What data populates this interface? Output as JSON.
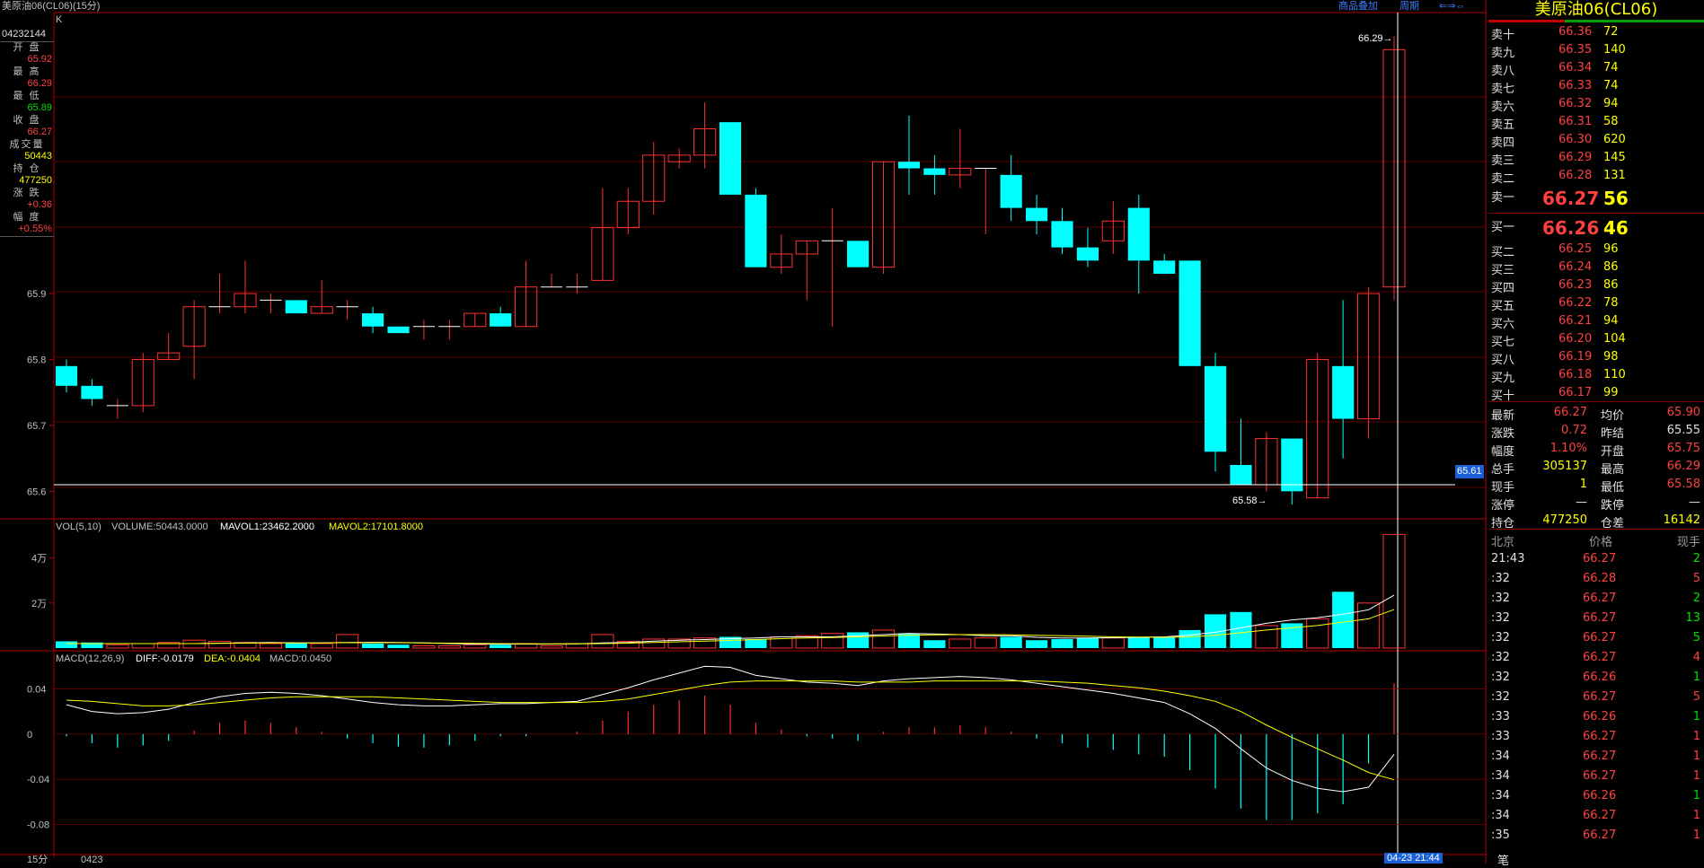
{
  "window_title": "美原油06(CL06)(15分)",
  "toolbar": {
    "overlay_label": "商品叠加",
    "period_label": "周期",
    "k_label": "K",
    "period_bottom": "15分",
    "date_bottom": "0423"
  },
  "info": {
    "code": "04232144",
    "open_label": "开 盘",
    "open": "65.92",
    "high_label": "最 高",
    "high": "66.29",
    "low_label": "最 低",
    "low": "65.89",
    "close_label": "收 盘",
    "close": "66.27",
    "vol_label": "成交量",
    "vol": "50443",
    "oi_label": "持 仓",
    "oi": "477250",
    "chg_label": "涨 跌",
    "chg": "+0.36",
    "pct_label": "幅 度",
    "pct": "+0.55%"
  },
  "price_marker": "65.61",
  "time_marker": "04-23 21:44",
  "high_annot": "66.29→",
  "low_annot": "65.58→",
  "vol_header": {
    "name": "VOL(5,10)",
    "volume": "VOLUME:50443.0000",
    "ma1": "MAVOL1:23462.2000",
    "ma2": "MAVOL2:17101.8000"
  },
  "macd_header": {
    "name": "MACD(12,26,9)",
    "diff": "DIFF:-0.0179",
    "dea": "DEA:-0.0404",
    "macd": "MACD:0.0450"
  },
  "colors": {
    "up": "#ff3030",
    "down": "#00ffff",
    "grid": "#7a0000",
    "ma1": "#ffffff",
    "ma2": "#ffff00"
  },
  "chart_data": {
    "type": "candlestick",
    "price_axis": {
      "ticks": [
        "65.6",
        "65.7",
        "65.8",
        "65.9"
      ],
      "ylim": [
        65.58,
        66.31
      ]
    },
    "vol_axis": {
      "ticks": [
        "2万",
        "4万"
      ],
      "ylim": [
        0,
        51000
      ]
    },
    "macd_axis": {
      "ticks": [
        "0.04",
        "0",
        "-0.04",
        "-0.08"
      ],
      "ylim": [
        -0.105,
        0.065
      ]
    },
    "candles": [
      [
        65.79,
        65.8,
        65.75,
        65.76
      ],
      [
        65.76,
        65.77,
        65.73,
        65.74
      ],
      [
        65.73,
        65.74,
        65.71,
        65.73
      ],
      [
        65.73,
        65.81,
        65.72,
        65.8
      ],
      [
        65.8,
        65.84,
        65.8,
        65.81
      ],
      [
        65.82,
        65.89,
        65.77,
        65.88
      ],
      [
        65.88,
        65.93,
        65.87,
        65.88
      ],
      [
        65.88,
        65.95,
        65.87,
        65.9
      ],
      [
        65.89,
        65.9,
        65.87,
        65.89
      ],
      [
        65.89,
        65.89,
        65.87,
        65.87
      ],
      [
        65.87,
        65.92,
        65.87,
        65.88
      ],
      [
        65.88,
        65.89,
        65.86,
        65.88
      ],
      [
        65.87,
        65.88,
        65.84,
        65.85
      ],
      [
        65.85,
        65.85,
        65.84,
        65.84
      ],
      [
        65.85,
        65.86,
        65.83,
        65.85
      ],
      [
        65.85,
        65.86,
        65.83,
        65.85
      ],
      [
        65.85,
        65.87,
        65.85,
        65.87
      ],
      [
        65.87,
        65.88,
        65.85,
        65.85
      ],
      [
        65.85,
        65.95,
        65.85,
        65.91
      ],
      [
        65.91,
        65.93,
        65.91,
        65.91
      ],
      [
        65.91,
        65.93,
        65.9,
        65.91
      ],
      [
        65.92,
        66.06,
        65.92,
        66.0
      ],
      [
        66.0,
        66.06,
        65.99,
        66.04
      ],
      [
        66.04,
        66.13,
        66.02,
        66.11
      ],
      [
        66.1,
        66.12,
        66.09,
        66.11
      ],
      [
        66.11,
        66.19,
        66.09,
        66.15
      ],
      [
        66.16,
        66.16,
        66.05,
        66.05
      ],
      [
        66.05,
        66.06,
        65.94,
        65.94
      ],
      [
        65.94,
        65.99,
        65.93,
        65.96
      ],
      [
        65.96,
        65.98,
        65.89,
        65.98
      ],
      [
        65.98,
        66.03,
        65.85,
        65.98
      ],
      [
        65.98,
        65.98,
        65.94,
        65.94
      ],
      [
        65.94,
        66.1,
        65.93,
        66.1
      ],
      [
        66.1,
        66.17,
        66.05,
        66.09
      ],
      [
        66.09,
        66.11,
        66.05,
        66.08
      ],
      [
        66.08,
        66.15,
        66.06,
        66.09
      ],
      [
        66.09,
        66.09,
        65.99,
        66.09
      ],
      [
        66.08,
        66.11,
        66.01,
        66.03
      ],
      [
        66.03,
        66.05,
        65.99,
        66.01
      ],
      [
        66.01,
        66.03,
        65.96,
        65.97
      ],
      [
        65.97,
        66.0,
        65.94,
        65.95
      ],
      [
        65.98,
        66.04,
        65.96,
        66.01
      ],
      [
        66.03,
        66.05,
        65.9,
        65.95
      ],
      [
        65.95,
        65.96,
        65.94,
        65.93
      ],
      [
        65.95,
        65.95,
        65.83,
        65.79
      ],
      [
        65.79,
        65.81,
        65.63,
        65.66
      ],
      [
        65.64,
        65.71,
        65.61,
        65.61
      ],
      [
        65.61,
        65.69,
        65.6,
        65.68
      ],
      [
        65.68,
        65.68,
        65.58,
        65.6
      ],
      [
        65.59,
        65.81,
        65.59,
        65.8
      ],
      [
        65.79,
        65.89,
        65.65,
        65.71
      ],
      [
        65.71,
        65.91,
        65.68,
        65.9
      ],
      [
        65.91,
        66.29,
        65.89,
        66.27
      ]
    ],
    "volume": [
      3000,
      2500,
      1500,
      2000,
      2500,
      3500,
      3000,
      2500,
      2000,
      2500,
      2000,
      6000,
      2000,
      1500,
      1000,
      1000,
      1500,
      1500,
      2000,
      1000,
      2000,
      6000,
      3000,
      4000,
      4000,
      4500,
      5000,
      4000,
      5000,
      5500,
      6500,
      7000,
      8000,
      6500,
      3500,
      4000,
      4500,
      5000,
      3500,
      4000,
      4500,
      4500,
      5000,
      5000,
      8000,
      15000,
      16000,
      10000,
      11000,
      13000,
      25000,
      20000,
      50443
    ],
    "ma1": [
      2000,
      2000,
      2000,
      2000,
      2000,
      2000,
      2200,
      2300,
      2500,
      2300,
      2300,
      2500,
      2600,
      2500,
      2300,
      2000,
      1800,
      1800,
      1800,
      1800,
      1900,
      2300,
      2500,
      3100,
      3500,
      3800,
      4200,
      4500,
      5000,
      5000,
      5000,
      5500,
      6000,
      6500,
      6300,
      6000,
      5500,
      5500,
      4800,
      4500,
      4500,
      4600,
      4800,
      5000,
      5800,
      7000,
      9000,
      11000,
      12500,
      13500,
      15000,
      17000,
      23462
    ],
    "ma2": [
      2000,
      2000,
      2000,
      2000,
      2000,
      2000,
      2100,
      2200,
      2300,
      2300,
      2300,
      2400,
      2400,
      2400,
      2300,
      2200,
      2100,
      2000,
      1900,
      1900,
      1900,
      2000,
      2200,
      2500,
      2800,
      3100,
      3400,
      3800,
      4200,
      4500,
      4700,
      5000,
      5400,
      5700,
      5900,
      6000,
      6000,
      5900,
      5700,
      5500,
      5300,
      5000,
      4900,
      4800,
      5000,
      5700,
      6800,
      8000,
      9000,
      10000,
      11500,
      13000,
      17102
    ],
    "diff": [
      0.026,
      0.02,
      0.018,
      0.019,
      0.022,
      0.028,
      0.033,
      0.036,
      0.037,
      0.036,
      0.034,
      0.031,
      0.028,
      0.026,
      0.025,
      0.025,
      0.026,
      0.027,
      0.027,
      0.028,
      0.029,
      0.035,
      0.041,
      0.048,
      0.054,
      0.06,
      0.059,
      0.052,
      0.049,
      0.046,
      0.045,
      0.043,
      0.047,
      0.049,
      0.05,
      0.051,
      0.05,
      0.048,
      0.045,
      0.042,
      0.039,
      0.036,
      0.032,
      0.028,
      0.018,
      0.005,
      -0.013,
      -0.03,
      -0.041,
      -0.048,
      -0.051,
      -0.047,
      -0.0179
    ],
    "dea": [
      0.03,
      0.029,
      0.027,
      0.025,
      0.025,
      0.026,
      0.028,
      0.03,
      0.032,
      0.033,
      0.033,
      0.033,
      0.033,
      0.032,
      0.031,
      0.03,
      0.029,
      0.028,
      0.028,
      0.028,
      0.028,
      0.029,
      0.031,
      0.035,
      0.039,
      0.043,
      0.046,
      0.047,
      0.047,
      0.047,
      0.047,
      0.046,
      0.046,
      0.046,
      0.047,
      0.047,
      0.047,
      0.047,
      0.047,
      0.046,
      0.045,
      0.043,
      0.041,
      0.038,
      0.034,
      0.029,
      0.02,
      0.008,
      -0.003,
      -0.013,
      -0.023,
      -0.034,
      -0.0404
    ],
    "macd": [
      -0.002,
      -0.008,
      -0.012,
      -0.01,
      -0.006,
      0.003,
      0.01,
      0.012,
      0.01,
      0.006,
      0.002,
      -0.004,
      -0.008,
      -0.011,
      -0.012,
      -0.01,
      -0.006,
      -0.002,
      -0.002,
      0,
      0.002,
      0.012,
      0.02,
      0.026,
      0.03,
      0.034,
      0.026,
      0.01,
      0.004,
      -0.002,
      -0.004,
      -0.006,
      0.002,
      0.006,
      0.006,
      0.008,
      0.006,
      0.002,
      -0.004,
      -0.008,
      -0.012,
      -0.014,
      -0.018,
      -0.02,
      -0.032,
      -0.048,
      -0.066,
      -0.076,
      -0.076,
      -0.07,
      -0.062,
      -0.026,
      0.045
    ]
  },
  "panel": {
    "title": "美原油06(CL06)",
    "asks": [
      {
        "label": "卖十",
        "price": "66.36",
        "vol": "72"
      },
      {
        "label": "卖九",
        "price": "66.35",
        "vol": "140"
      },
      {
        "label": "卖八",
        "price": "66.34",
        "vol": "74"
      },
      {
        "label": "卖七",
        "price": "66.33",
        "vol": "74"
      },
      {
        "label": "卖六",
        "price": "66.32",
        "vol": "94"
      },
      {
        "label": "卖五",
        "price": "66.31",
        "vol": "58"
      },
      {
        "label": "卖四",
        "price": "66.30",
        "vol": "620"
      },
      {
        "label": "卖三",
        "price": "66.29",
        "vol": "145"
      },
      {
        "label": "卖二",
        "price": "66.28",
        "vol": "131"
      }
    ],
    "ask1": {
      "label": "卖一",
      "price": "66.27",
      "vol": "56"
    },
    "bid1": {
      "label": "买一",
      "price": "66.26",
      "vol": "46"
    },
    "bids": [
      {
        "label": "买二",
        "price": "66.25",
        "vol": "96"
      },
      {
        "label": "买三",
        "price": "66.24",
        "vol": "86"
      },
      {
        "label": "买四",
        "price": "66.23",
        "vol": "86"
      },
      {
        "label": "买五",
        "price": "66.22",
        "vol": "78"
      },
      {
        "label": "买六",
        "price": "66.21",
        "vol": "94"
      },
      {
        "label": "买七",
        "price": "66.20",
        "vol": "104"
      },
      {
        "label": "买八",
        "price": "66.19",
        "vol": "98"
      },
      {
        "label": "买九",
        "price": "66.18",
        "vol": "110"
      },
      {
        "label": "买十",
        "price": "66.17",
        "vol": "99"
      }
    ],
    "stats": [
      {
        "l1": "最新",
        "v1": "66.27",
        "c1": "red",
        "l2": "均价",
        "v2": "65.90",
        "c2": "red"
      },
      {
        "l1": "涨跌",
        "v1": "0.72",
        "c1": "red",
        "l2": "昨结",
        "v2": "65.55",
        "c2": "wht"
      },
      {
        "l1": "幅度",
        "v1": "1.10%",
        "c1": "red",
        "l2": "开盘",
        "v2": "65.75",
        "c2": "red"
      },
      {
        "l1": "总手",
        "v1": "305137",
        "c1": "yel",
        "l2": "最高",
        "v2": "66.29",
        "c2": "red"
      },
      {
        "l1": "现手",
        "v1": "1",
        "c1": "yel",
        "l2": "最低",
        "v2": "65.58",
        "c2": "red"
      },
      {
        "l1": "涨停",
        "v1": "—",
        "c1": "wht",
        "l2": "跌停",
        "v2": "—",
        "c2": "wht"
      },
      {
        "l1": "持仓",
        "v1": "477250",
        "c1": "yel",
        "l2": "仓差",
        "v2": "16142",
        "c2": "yel"
      }
    ],
    "ticks_header": {
      "time": "北京",
      "price": "价格",
      "vol": "现手"
    },
    "ticks": [
      {
        "t": "21:43",
        "p": "66.27",
        "v": "2",
        "vc": "green"
      },
      {
        "t": ":32",
        "p": "66.28",
        "v": "5",
        "vc": "red"
      },
      {
        "t": ":32",
        "p": "66.27",
        "v": "2",
        "vc": "green"
      },
      {
        "t": ":32",
        "p": "66.27",
        "v": "13",
        "vc": "green"
      },
      {
        "t": ":32",
        "p": "66.27",
        "v": "5",
        "vc": "green"
      },
      {
        "t": ":32",
        "p": "66.27",
        "v": "4",
        "vc": "red"
      },
      {
        "t": ":32",
        "p": "66.26",
        "v": "1",
        "vc": "green"
      },
      {
        "t": ":32",
        "p": "66.27",
        "v": "5",
        "vc": "red"
      },
      {
        "t": ":33",
        "p": "66.26",
        "v": "1",
        "vc": "green"
      },
      {
        "t": ":33",
        "p": "66.27",
        "v": "1",
        "vc": "red"
      },
      {
        "t": ":34",
        "p": "66.27",
        "v": "1",
        "vc": "red"
      },
      {
        "t": ":34",
        "p": "66.27",
        "v": "1",
        "vc": "red"
      },
      {
        "t": ":34",
        "p": "66.26",
        "v": "1",
        "vc": "green"
      },
      {
        "t": ":34",
        "p": "66.27",
        "v": "1",
        "vc": "red"
      },
      {
        "t": ":35",
        "p": "66.27",
        "v": "1",
        "vc": "red"
      }
    ],
    "footer": "笔"
  }
}
